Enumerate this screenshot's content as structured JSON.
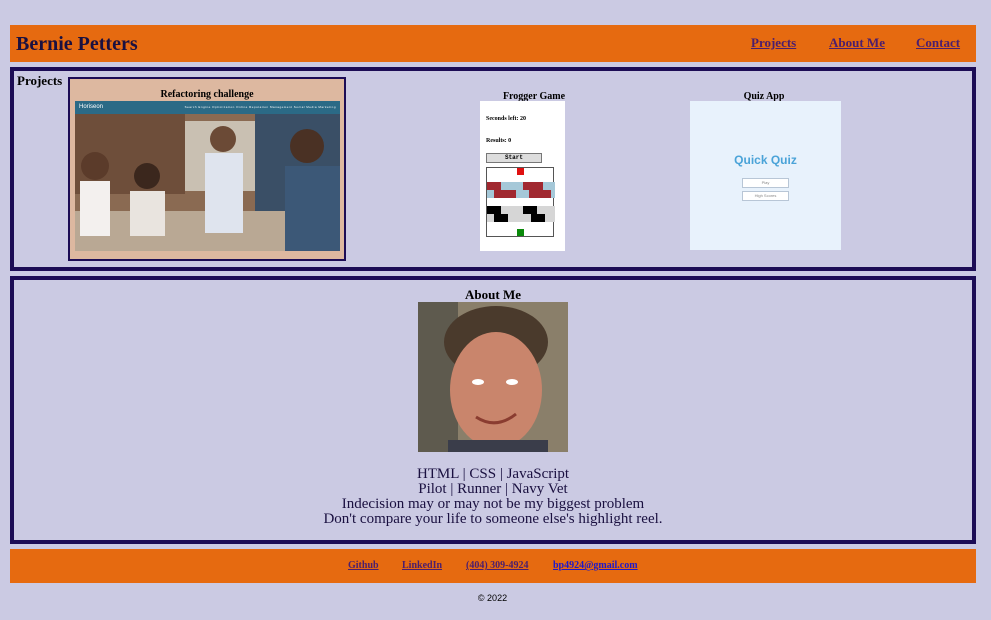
{
  "header": {
    "title": "Bernie Petters",
    "nav": [
      "Projects",
      "About Me",
      "Contact"
    ],
    "bg_color": "#e66a10"
  },
  "projects": {
    "heading": "Projects",
    "items": [
      {
        "title": "Refactoring challenge",
        "screenshot": {
          "brand": "Horiseon",
          "nav_text": "Search Engine Optimization   Online Reputation Management   Social Media Marketing"
        }
      },
      {
        "title": "Frogger Game",
        "screenshot": {
          "seconds_label": "Seconds left: 20",
          "results_label": "Results: 0",
          "start_label": "Start"
        }
      },
      {
        "title": "Quiz App",
        "screenshot": {
          "title": "Quick Quiz",
          "buttons": [
            "Play",
            "High Scores"
          ]
        }
      }
    ]
  },
  "about": {
    "heading": "About Me",
    "lines": [
      "HTML | CSS | JavaScript",
      "Pilot | Runner | Navy Vet",
      "Indecision may or may not be my biggest problem",
      "Don't compare your life to someone else's highlight reel."
    ]
  },
  "footer": {
    "links": [
      "Github",
      "LinkedIn",
      "(404) 309-4924",
      "bp4924@gmail.com"
    ],
    "copyright": "© 2022"
  },
  "colors": {
    "background": "#cbcae3",
    "panel_border": "#1c0c55",
    "link": "#4b1e6e",
    "email_link": "#2019c8"
  }
}
